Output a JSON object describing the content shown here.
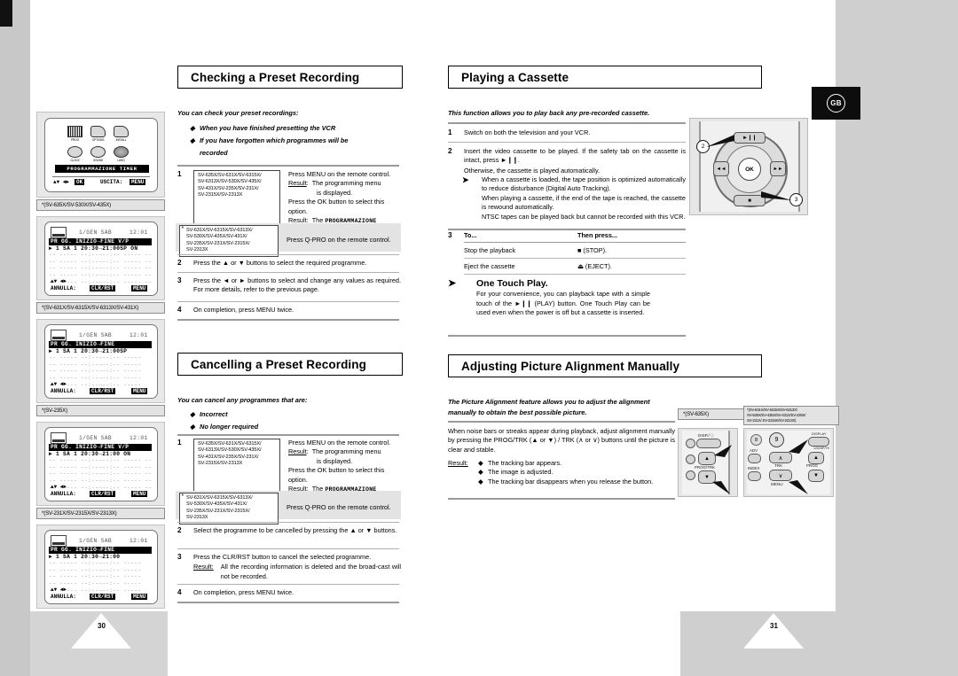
{
  "badge": {
    "locale": "GB"
  },
  "pages": {
    "left_number": "30",
    "right_number": "31"
  },
  "left_page": {
    "sections": [
      {
        "id": "checking",
        "title": "Checking a Preset Recording",
        "intro": "You can check your preset recordings:",
        "bullets": [
          "When you have finished presetting the VCR",
          "If you have forgotten which programmes will be",
          "recorded"
        ],
        "steps": [
          {
            "num": "1",
            "models": "SV-635X/SV-631X/SV-6315X/ SV-6313X/SV-530X/SV-435X/ SV-431X/SV-235X/SV-231X/ SV-2315X/SV-2313X",
            "model_lines": [
              "SV-635X/SV-631X/SV-6315X/",
              "SV-6313X/SV-530X/SV-435X/",
              "SV-431X/SV-235X/SV-231X/",
              "SV-2315X/SV-2313X"
            ],
            "instr_lines": [
              "Press MENU on the remote control.",
              "Result:   The programming menu",
              "is displayed.",
              "Press the OK button to select this option.",
              "Result:   The PROGRAMMAZIONE",
              "TIMER menu is displayed."
            ]
          },
          {
            "num": "",
            "starred": true,
            "model_lines": [
              "SV-631X/SV-6315X/SV-6313X/",
              "SV-530X/SV-435X/SV-431X/",
              "SV-235X/SV-231X/SV-2315X/",
              "SV-2313X"
            ],
            "instr_lines": [
              "Press Q-PRO on the remote control."
            ]
          },
          {
            "num": "2",
            "text": "Press the ▲ or ▼ buttons to select the required programme."
          },
          {
            "num": "3",
            "text": "Press the ◄ or ► buttons to select and change any values as required. For more details, refer to the previous page."
          },
          {
            "num": "4",
            "text": "On completion, press MENU twice."
          }
        ]
      },
      {
        "id": "cancelling",
        "title": "Cancelling a Preset Recording",
        "intro": "You can cancel any programmes that are:",
        "bullets": [
          "Incorrect",
          "No longer required"
        ],
        "steps": [
          {
            "num": "1",
            "model_lines": [
              "SV-635X/SV-631X/SV-6315X/",
              "SV-6313X/SV-530X/SV-435X/",
              "SV-431X/SV-235X/SV-231X/",
              "SV-2315X/SV-2313X"
            ],
            "instr_lines": [
              "Press MENU on the remote control.",
              "Result:   The programming menu",
              "is displayed.",
              "Press the OK button to select this option.",
              "Result:   The PROGRAMMAZIONE",
              "TIMER menu is displayed."
            ]
          },
          {
            "num": "",
            "starred": true,
            "model_lines": [
              "SV-631X/SV-6315X/SV-6313X/",
              "SV-530X/SV-435X/SV-431X/",
              "SV-235X/SV-231X/SV-2315X/",
              "SV-2313X"
            ],
            "instr_lines": [
              "Press Q-PRO on the remote control."
            ]
          },
          {
            "num": "2",
            "text": "Select the programme to be cancelled by pressing the ▲ or ▼ buttons."
          },
          {
            "num": "3",
            "text": "Press the CLR/RST button to cancel the selected programme.",
            "result_label": "Result:",
            "result_text": "All the recording information is deleted and the broad-cast will not be recorded."
          },
          {
            "num": "4",
            "text": "On completion, press MENU twice."
          }
        ]
      }
    ],
    "screens": [
      {
        "id": "menu-screen",
        "caption": "*(SV-635X/SV-530X/SV-435X)",
        "type": "menu",
        "icons": [
          {
            "label": "PROG"
          },
          {
            "label": "OPTIONS"
          },
          {
            "label": "INSTALL"
          },
          {
            "label": "CLOCK"
          },
          {
            "label": "SOUND"
          },
          {
            "label": "LANG"
          }
        ],
        "highlight": "PROGRAMMAZIONE TIMER",
        "footer_left": "▲▼ ◄►",
        "footer_key1": "OK",
        "footer_right": "USCITA:",
        "footer_key2": "MENU"
      },
      {
        "id": "timer-screen-1",
        "caption": "*(SV-631X/SV-6315X/SV-6313X/SV-431X)",
        "type": "timer",
        "date": "1/GEN  SAB",
        "time": "12:01",
        "header": "PR  GG. INIZIO→FINE    V/P",
        "row": "► 1  SA 1 20:30→21:00SP   ON",
        "empty_row": "--  ----- --:--→--:-- -----   --",
        "rows": 6,
        "foot_nav": "▲▼ ◄►",
        "foot_label": "ANNULLA:",
        "foot_key1": "CLR/RST",
        "foot_key2": "MENU"
      },
      {
        "id": "timer-screen-2",
        "caption": "*(SV-235X)",
        "type": "timer",
        "date": "1/GEN  SAB",
        "time": "12:01",
        "header": "PR  GG. INIZIO→FINE",
        "row": "► 1  SA 1 20:30→21:00SP",
        "empty_row": "--  ----- --:--→--:-- -----",
        "rows": 6,
        "foot_nav": "▲▼ ◄►",
        "foot_label": "ANNULLA:",
        "foot_key1": "CLR/RST",
        "foot_key2": "MENU"
      },
      {
        "id": "timer-screen-3",
        "caption": "*(SV-231X/SV-2315X/SV-2313X)",
        "type": "timer",
        "date": "1/GEN  SAB",
        "time": "12:01",
        "header": "PR  GG. INIZIO→FINE    V/P",
        "row": "► 1  SA 1 20:30→21:00     ON",
        "empty_row": "--  ----- --:--→--:-- -----   --",
        "rows": 6,
        "foot_nav": "▲▼ ◄►",
        "foot_label": "ANNULLA:",
        "foot_key1": "CLR/RST",
        "foot_key2": "MENU"
      },
      {
        "id": "timer-screen-4",
        "caption": "*(SV-231X/SV-2315X/SV-2313X)",
        "type": "timer",
        "date": "1/GEN  SAB",
        "time": "12:01",
        "header": "PR  GG. INIZIO→FINE",
        "row": "► 1  SA 1 20:30→21:00",
        "empty_row": "--  ----- --:--→--:-- -----",
        "rows": 6,
        "foot_nav": "▲▼ ◄►",
        "foot_label": "ANNULLA:",
        "foot_key1": "CLR/RST",
        "foot_key2": "MENU"
      }
    ]
  },
  "right_page": {
    "sections": [
      {
        "id": "playing",
        "title": "Playing a Cassette",
        "intro": "This function allows you to play back any pre-recorded cassette.",
        "steps": [
          {
            "num": "1",
            "text": "Switch on both the television and your VCR."
          },
          {
            "num": "2",
            "text": "Insert the video cassette to be played. If the safety tab on the cassette is intact, press ►❙❙.",
            "extra": "Otherwise, the cassette is played automatically."
          }
        ],
        "notes": [
          "When a cassette is loaded, the tape position is optimized automatically to reduce disturbance (Digital Auto Tracking).",
          "When playing a cassette, if the end of the tape is reached, the cassette is rewound automatically.",
          "NTSC tapes can be played back but cannot be recorded with this VCR."
        ],
        "table": {
          "num": "3",
          "headers": [
            "To...",
            "Then press..."
          ],
          "rows": [
            [
              "Stop the playback",
              "■ (STOP)."
            ],
            [
              "Eject the cassette",
              "⏏ (EJECT)."
            ]
          ]
        },
        "tip": {
          "title": "One Touch Play.",
          "text": "For your convenience, you can playback tape with a simple touch of the ►❙❙ (PLAY) button. One Touch Play can be used even when the power is off but a cassette is inserted."
        }
      },
      {
        "id": "alignment",
        "title": "Adjusting Picture Alignment Manually",
        "intro_lines": [
          "The Picture Alignment feature allows you to adjust the alignment",
          "manually to obtain the best possible picture."
        ],
        "body": "When noise bars or streaks appear during playback, adjust alignment manually by pressing the PROG/TRK (▲ or ▼) / TRK (∧ or ∨) buttons until the picture is clear and stable.",
        "result_label": "Result:",
        "result_bullets": [
          "The tracking bar appears.",
          "The image is adjusted.",
          "The tracking bar disappears when you release the button."
        ]
      }
    ],
    "remotes": [
      {
        "id": "remote-play",
        "callouts": [
          "2",
          "3"
        ],
        "buttons": [
          {
            "name": "play-pause-button",
            "label": "►❙❙"
          },
          {
            "name": "rewind-button",
            "label": "◄◄"
          },
          {
            "name": "ok-button",
            "label": "OK"
          },
          {
            "name": "forward-button",
            "label": "►►"
          },
          {
            "name": "stop-button",
            "label": "■"
          }
        ]
      },
      {
        "id": "remote-progtrk",
        "caption": "*(SV-635X)",
        "buttons": [
          {
            "name": "disp-button",
            "label": "DISP./⚪"
          },
          {
            "name": "prog-trk-up-button",
            "label": "▲"
          },
          {
            "name": "prog-trk-down-button",
            "label": "▼"
          }
        ],
        "labels": [
          "DISP./⚪",
          "PROG/TRK",
          "MENU"
        ]
      },
      {
        "id": "remote-trk",
        "caption_lines": [
          "*(SV-631X/SV-6315X/SV-6313X/",
          "SV-530X/SV-435X/SV-431X/SV-235X/",
          "SV-231X/ SV-2315X/SV-2313X)"
        ],
        "labels": [
          "9",
          "ADV",
          "INDEX",
          "TRK",
          "PROG",
          "MENU",
          "DISPLAY",
          "12/DSP/TK"
        ]
      }
    ]
  }
}
